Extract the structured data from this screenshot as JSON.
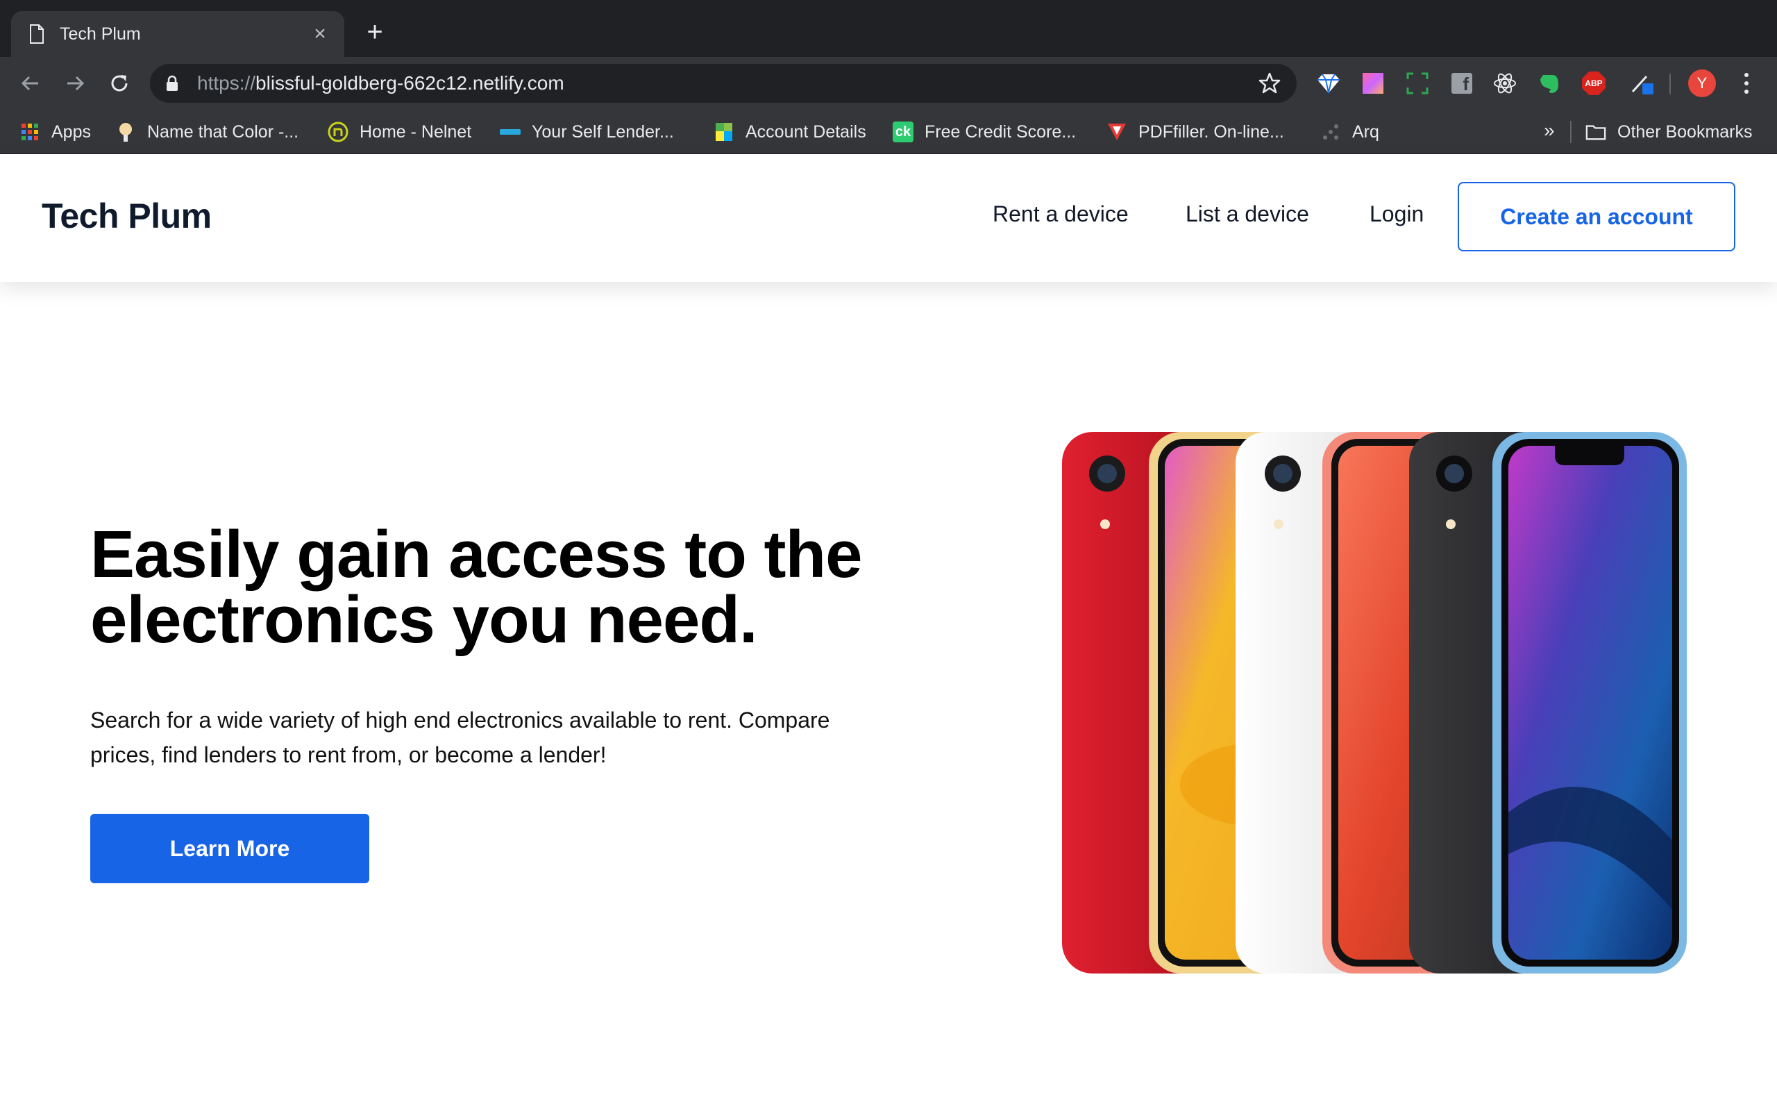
{
  "browser": {
    "tab_title": "Tech Plum",
    "tab_close": "×",
    "new_tab": "+",
    "url_scheme": "https://",
    "url_host": "blissful-goldberg-662c12.netlify.com",
    "avatar_letter": "Y",
    "bookmarks": [
      {
        "label": "Apps",
        "icon": "apps-grid-icon"
      },
      {
        "label": "Name that Color -...",
        "icon": "color-picker-icon"
      },
      {
        "label": "Home - Nelnet",
        "icon": "nelnet-icon"
      },
      {
        "label": "Your Self Lender...",
        "icon": "self-lender-icon"
      },
      {
        "label": "Account Details",
        "icon": "account-details-icon"
      },
      {
        "label": "Free Credit Score...",
        "icon": "credit-karma-icon"
      },
      {
        "label": "PDFfiller. On-line...",
        "icon": "pdffiller-icon"
      },
      {
        "label": "Arq",
        "icon": "arq-icon"
      }
    ],
    "bookmarks_overflow": "»",
    "other_bookmarks": "Other Bookmarks",
    "extensions": [
      "sketch-icon",
      "gradient-icon",
      "screenshot-icon",
      "facebook-icon",
      "react-devtools-icon",
      "evernote-icon",
      "adblock-plus-icon",
      "color-picker-ext-icon"
    ],
    "abp_text": "ABP",
    "ck_text": "ck"
  },
  "site": {
    "logo": "Tech Plum",
    "nav": {
      "rent": "Rent a device",
      "list": "List a device",
      "login": "Login",
      "create_account": "Create an account"
    },
    "hero": {
      "title": "Easily gain access to the electronics you need.",
      "subtitle": "Search for a wide variety of high end electronics available to rent. Compare prices, find lenders to rent from, or become a lender!",
      "cta": "Learn More",
      "image": "iphone-xr-lineup",
      "phone_colors": [
        "#c2101f",
        "#f5b829",
        "#f4f4f4",
        "#f46a52",
        "#2a2a2c",
        "#5aa6dc"
      ]
    },
    "accent_color": "#1764e6"
  }
}
